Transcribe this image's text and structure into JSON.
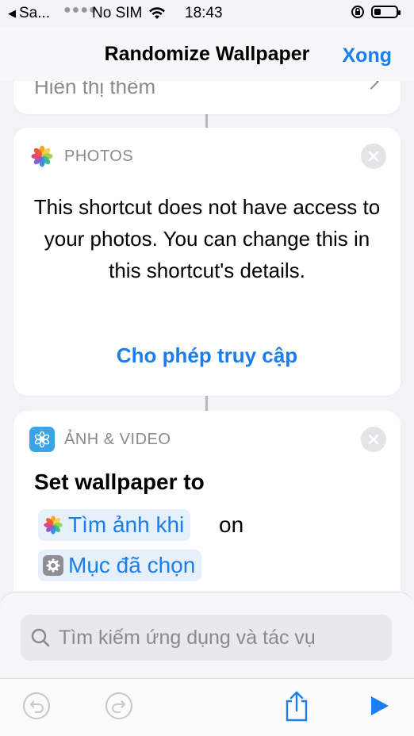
{
  "status_bar": {
    "back_app": "Sa...",
    "carrier": "No SIM",
    "time": "18:43"
  },
  "nav": {
    "title": "Randomize Wallpaper",
    "done_label": "Xong"
  },
  "previous_action": {
    "show_more_label": "Hiển thị thêm"
  },
  "photos_card": {
    "app_label": "PHOTOS",
    "message": "This shortcut does not have access to your photos. You can change this in this shortcut's details.",
    "allow_label": "Cho phép truy cập"
  },
  "media_card": {
    "app_label": "ẢNH & VIDEO",
    "action_text": "Set wallpaper to",
    "token_find_photos": "Tìm ảnh khi",
    "on_text": "on",
    "token_selected": "Mục đã chọn"
  },
  "search": {
    "placeholder": "Tìm kiếm ứng dụng và tác vụ"
  },
  "colors": {
    "accent": "#1a7df0",
    "background": "#f2f2f7",
    "media_icon": "#3aa4e6"
  },
  "icons": [
    "back-arrow-icon",
    "wifi-icon",
    "orientation-lock-icon",
    "battery-icon",
    "photos-icon",
    "close-icon",
    "media-icon",
    "gear-icon",
    "search-icon",
    "undo-icon",
    "redo-icon",
    "share-icon",
    "play-icon",
    "chevron-right-icon"
  ]
}
